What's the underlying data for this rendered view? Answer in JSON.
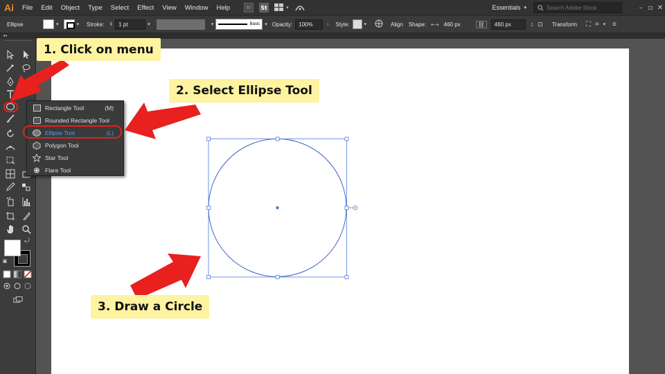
{
  "app": {
    "logo": "Ai"
  },
  "menubar": {
    "items": [
      "File",
      "Edit",
      "Object",
      "Type",
      "Select",
      "Effect",
      "View",
      "Window",
      "Help"
    ],
    "bridge_label": "Br",
    "stock_label": "St",
    "workspace": "Essentials",
    "search_placeholder": "Search Adobe Stock"
  },
  "controlbar": {
    "selection": "Ellipse",
    "stroke_label": "Stroke:",
    "stroke_value": "1 pt",
    "brush_label": "Basic",
    "opacity_label": "Opacity:",
    "opacity_value": "100%",
    "style_label": "Style:",
    "align_label": "Align",
    "shape_label": "Shape:",
    "width_value": "460 px",
    "height_value": "460 px",
    "transform_label": "Transform"
  },
  "flyout": {
    "items": [
      {
        "label": "Rectangle Tool",
        "shortcut": "(M)",
        "icon": "rectangle-icon"
      },
      {
        "label": "Rounded Rectangle Tool",
        "shortcut": "",
        "icon": "rounded-rectangle-icon"
      },
      {
        "label": "Ellipse Tool",
        "shortcut": "(L)",
        "icon": "ellipse-icon"
      },
      {
        "label": "Polygon Tool",
        "shortcut": "",
        "icon": "polygon-icon"
      },
      {
        "label": "Star Tool",
        "shortcut": "",
        "icon": "star-icon"
      },
      {
        "label": "Flare Tool",
        "shortcut": "",
        "icon": "flare-icon"
      }
    ],
    "selected_item": "Ellipse Tool"
  },
  "callouts": {
    "step1": "1. Click on menu",
    "step2": "2. Select Ellipse Tool",
    "step3": "3. Draw a Circle"
  },
  "colors": {
    "arrow": "#e8201e",
    "callout_bg": "#fef3a1",
    "selection_blue": "#4a7be0",
    "menu_bg": "#323232",
    "panel_bg": "#3c3c3c",
    "pasteboard": "#535353",
    "ai_orange": "#e8892b"
  }
}
